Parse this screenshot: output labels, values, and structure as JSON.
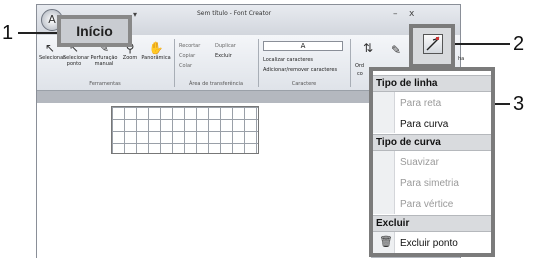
{
  "window": {
    "title": "Sem título - Font Creator",
    "minimize": "–",
    "close": "x"
  },
  "qat": {
    "arrow": "▾"
  },
  "tabs": {
    "home": "Início"
  },
  "ribbon": {
    "tools": [
      {
        "label": "Selecionar",
        "icon": "↖",
        "name": "select"
      },
      {
        "label": "Selecionar ponto",
        "icon": "↖",
        "name": "select-point"
      },
      {
        "label": "Perfuração manual",
        "icon": "✎",
        "name": "manual-punch"
      },
      {
        "label": "Zoom",
        "icon": "⚲",
        "name": "zoom"
      },
      {
        "label": "Panorâmica",
        "icon": "✋",
        "name": "pan"
      }
    ],
    "group_tools": "Ferramentas",
    "clipboard": {
      "cut": "Recortar",
      "duplicate": "Duplicar",
      "copy": "Copiar",
      "delete": "Excluir",
      "paste": "Colar"
    },
    "group_transfer": "Área de transferência",
    "character": {
      "value": "A",
      "find": "Localizar caracteres",
      "add_remove": "Adicionar/remover caracteres"
    },
    "group_character": "Caractere",
    "order": "Ord",
    "order2": "co",
    "right_partial": "ha"
  },
  "callouts": {
    "one": "1",
    "two": "2",
    "three": "3"
  },
  "menu": {
    "line_type_header": "Tipo de linha",
    "to_straight": "Para reta",
    "to_curve": "Para curva",
    "curve_type_header": "Tipo de curva",
    "smooth": "Suavizar",
    "symmetry": "Para simetria",
    "vertex": "Para vértice",
    "delete_header": "Excluir",
    "delete_point": "Excluir ponto"
  }
}
